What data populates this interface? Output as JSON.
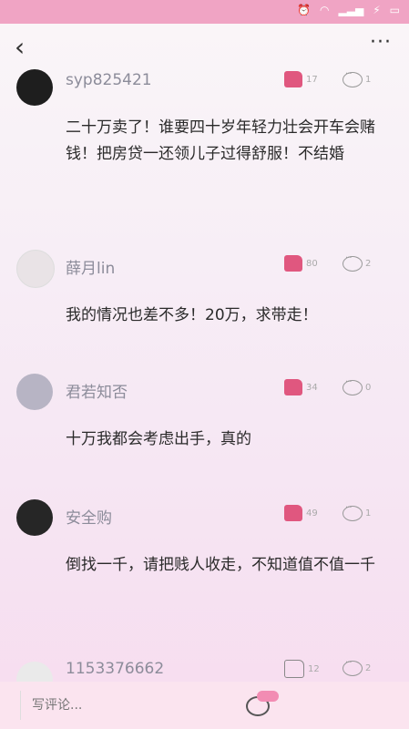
{
  "navbar": {
    "back_icon": "‹",
    "more_icon": "···"
  },
  "comments": [
    {
      "username": "syp825421",
      "meta": "",
      "likes": "17",
      "replies": "1",
      "text": "二十万卖了！谁要四十岁年轻力壮会开车会赌钱！把房贷一还领儿子过得舒服！不结婚"
    },
    {
      "username": "薛月lin",
      "meta": "",
      "likes": "80",
      "replies": "2",
      "text": "我的情况也差不多！20万，求带走！"
    },
    {
      "username": "君若知否",
      "meta": "",
      "likes": "34",
      "replies": "0",
      "text": "十万我都会考虑出手，真的"
    },
    {
      "username": "安全购",
      "meta": "",
      "likes": "49",
      "replies": "1",
      "text": "倒找一千，请把贱人收走，不知道值不值一千"
    },
    {
      "username": "1153376662",
      "meta": "",
      "likes": "12",
      "replies": "2",
      "text": ""
    }
  ],
  "bottom": {
    "placeholder": "写评论...",
    "badge": ""
  },
  "colors": {
    "status_bar": "#f0a4c4",
    "like": "#e0577f"
  }
}
